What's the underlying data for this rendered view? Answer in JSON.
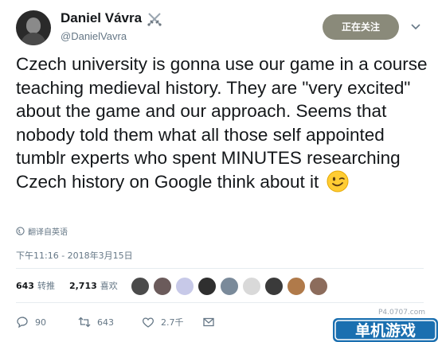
{
  "author": {
    "name": "Daniel Vávra",
    "handle": "@DanielVavra",
    "badge_icon": "crossed-swords-icon"
  },
  "follow_button": {
    "label": "正在关注"
  },
  "tweet": {
    "text": "Czech university is gonna use our game in a course teaching medieval history. They are \"very excited\" about the game and our approach. Seems that nobody told them what all those self appointed tumblr experts who spent MINUTES researching Czech history on Google think about it",
    "emoji": "winking-face-icon",
    "translate_label": "翻译自英语",
    "timestamp": "下午11:16 - 2018年3月15日"
  },
  "stats": {
    "retweets_count": "643",
    "retweets_label": "转推",
    "likes_count": "2,713",
    "likes_label": "喜欢"
  },
  "liker_avatar_colors": [
    "#4b4b4b",
    "#6b5b5b",
    "#c7c9e8",
    "#2f2f2f",
    "#7a8a9a",
    "#d9d9d9",
    "#3a3a3a",
    "#b07a4a",
    "#8c6c5c"
  ],
  "actions": {
    "reply_count": "90",
    "retweet_count": "643",
    "like_count": "2.7千"
  },
  "watermark": {
    "small": "P4.0707.com",
    "large": "单机游戏"
  },
  "colors": {
    "follow_bg": "#8a8a7a",
    "secondary_text": "#657786",
    "watermark_bg": "#1a6fb0"
  }
}
